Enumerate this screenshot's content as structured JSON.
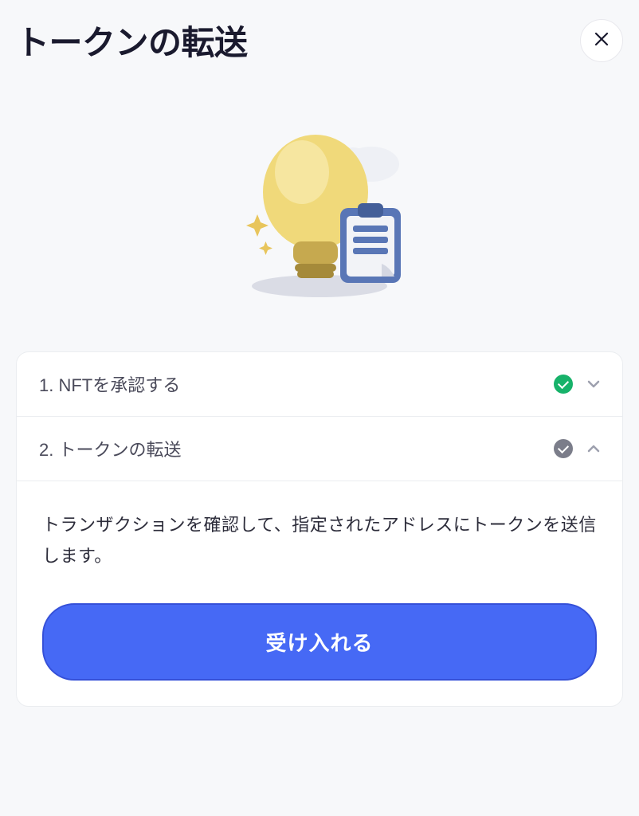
{
  "modal": {
    "title": "トークンの転送"
  },
  "steps": [
    {
      "label": "1. NFTを承認する",
      "status": "complete"
    },
    {
      "label": "2. トークンの転送",
      "status": "current",
      "description": "トランザクションを確認して、指定されたアドレスにトークンを送信します。",
      "button": "受け入れる"
    }
  ]
}
